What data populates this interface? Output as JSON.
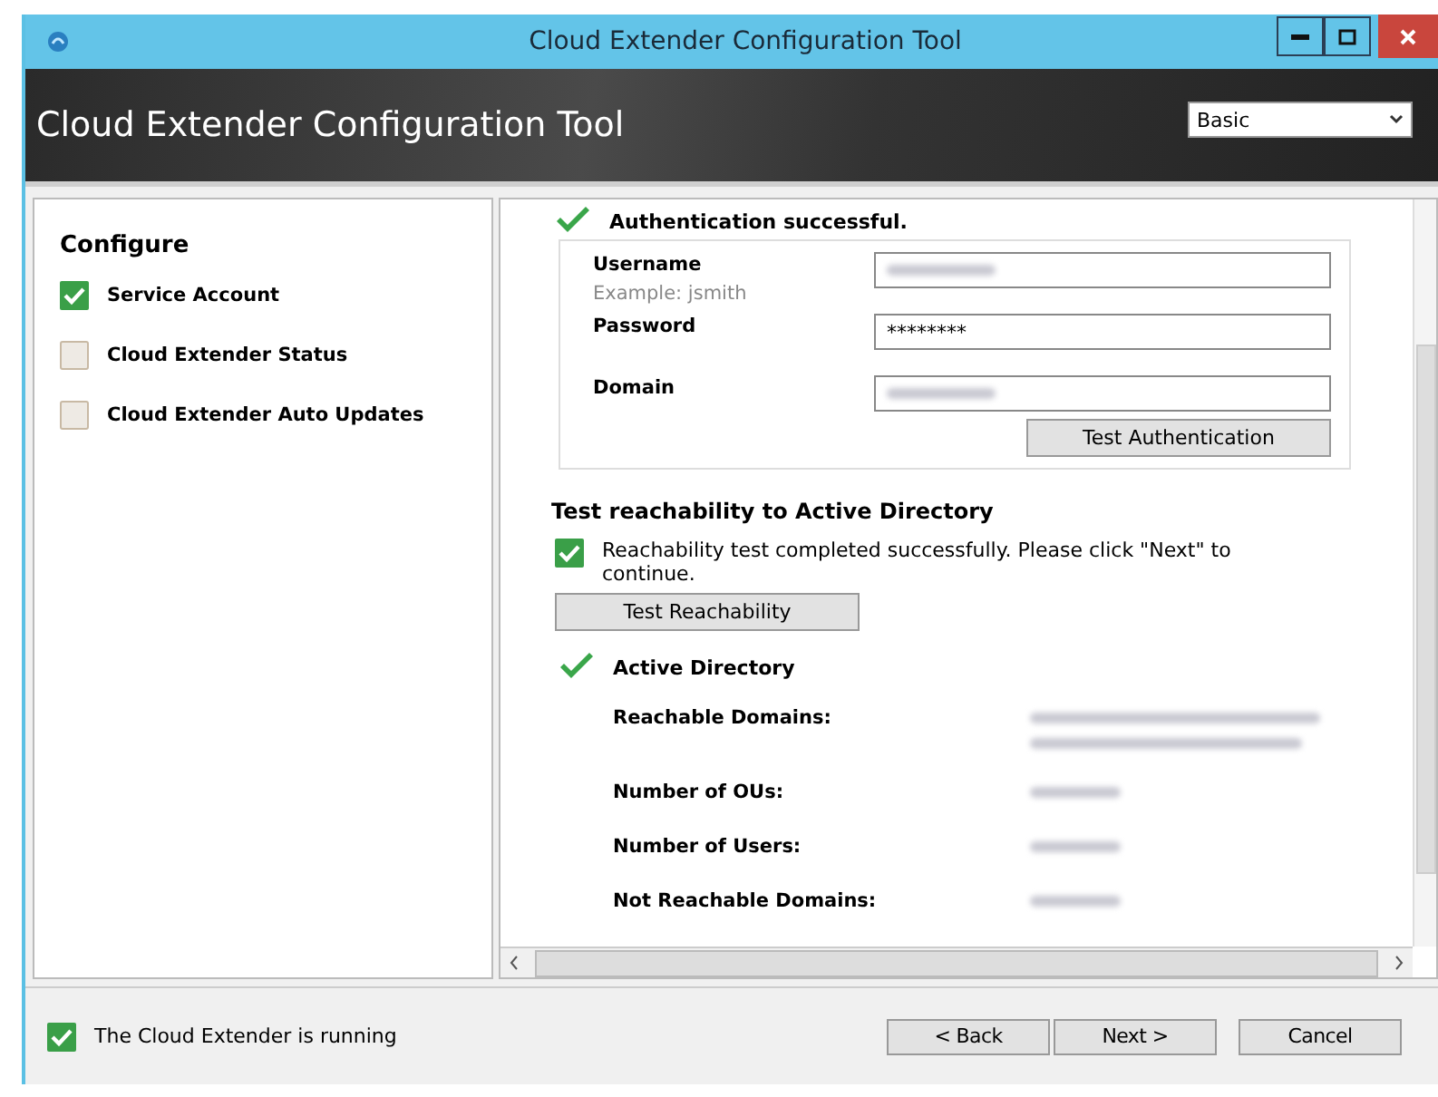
{
  "window": {
    "title": "Cloud Extender Configuration Tool"
  },
  "header": {
    "title": "Cloud Extender Configuration Tool",
    "mode_select": {
      "value": "Basic"
    }
  },
  "sidebar": {
    "heading": "Configure",
    "items": [
      {
        "label": "Service Account",
        "checked": true
      },
      {
        "label": "Cloud Extender Status",
        "checked": false
      },
      {
        "label": "Cloud Extender Auto Updates",
        "checked": false
      }
    ]
  },
  "auth": {
    "status": "Authentication successful.",
    "fields": [
      {
        "label": "Username",
        "hint": "Example:  jsmith",
        "kind": "redacted"
      },
      {
        "label": "Password",
        "value": "********",
        "kind": "text"
      },
      {
        "label": "Domain",
        "kind": "redacted"
      }
    ],
    "button": "Test Authentication"
  },
  "reachability": {
    "heading": "Test reachability to Active Directory",
    "checked": true,
    "message": "Reachability test completed successfully. Please click \"Next\" to continue.",
    "button": "Test Reachability"
  },
  "directory": {
    "title": "Active Directory",
    "details": [
      {
        "label": "Reachable Domains:",
        "kind": "redacted_list"
      },
      {
        "label": "Number of OUs:",
        "kind": "redacted"
      },
      {
        "label": "Number of Users:",
        "kind": "redacted"
      },
      {
        "label": "Not Reachable Domains:",
        "kind": "redacted"
      }
    ]
  },
  "footer": {
    "status": "The Cloud Extender is running",
    "checked": true,
    "buttons": [
      "< Back",
      "Next >",
      "Cancel"
    ]
  }
}
